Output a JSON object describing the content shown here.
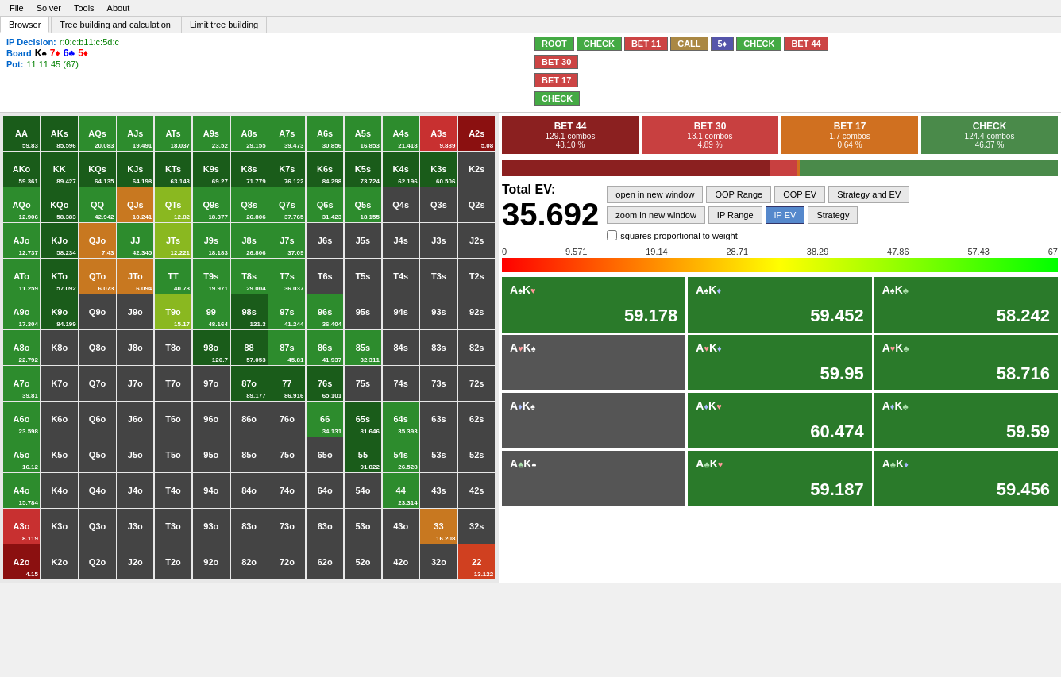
{
  "menubar": {
    "items": [
      "File",
      "Solver",
      "Tools",
      "About"
    ]
  },
  "tabs": {
    "items": [
      "Browser",
      "Tree building and calculation",
      "Limit tree building"
    ],
    "active": 0
  },
  "info": {
    "ip_decision_label": "IP Decision:",
    "ip_decision_value": "r:0:c:b11:c:5d:c",
    "board_label": "Board",
    "board_cards": [
      {
        "rank": "K",
        "suit": "♠",
        "color": "black"
      },
      {
        "rank": "7",
        "suit": "♦",
        "color": "red"
      },
      {
        "rank": "6",
        "suit": "♣",
        "color": "blue"
      },
      {
        "rank": "5",
        "suit": "♦",
        "color": "red"
      }
    ],
    "pot_label": "Pot:",
    "pot_value": "11 11 45 (67)"
  },
  "decision_path": [
    {
      "label": "ROOT",
      "class": "btn-root"
    },
    {
      "label": "CHECK",
      "class": "btn-check-g"
    },
    {
      "label": "BET 11",
      "class": "btn-bet11"
    },
    {
      "label": "CALL",
      "class": "btn-call"
    },
    {
      "label": "5♦",
      "class": "btn-5d"
    },
    {
      "label": "CHECK",
      "class": "btn-check-g2"
    },
    {
      "label": "BET 44",
      "class": "btn-bet44"
    },
    {
      "label": "BET 30",
      "class": "btn-bet30"
    },
    {
      "label": "BET 17",
      "class": "btn-bet17"
    },
    {
      "label": "CHECK",
      "class": "btn-check-g3"
    }
  ],
  "action_bars": [
    {
      "name": "BET 44",
      "combos": "129.1 combos",
      "pct": "48.10 %",
      "class": "ab-bet44"
    },
    {
      "name": "BET 30",
      "combos": "13.1 combos",
      "pct": "4.89 %",
      "class": "ab-bet30"
    },
    {
      "name": "BET 17",
      "combos": "1.7 combos",
      "pct": "0.64 %",
      "class": "ab-bet17"
    },
    {
      "name": "CHECK",
      "combos": "124.4 combos",
      "pct": "46.37 %",
      "class": "ab-check"
    }
  ],
  "freq_segments": [
    {
      "pct": 48.1,
      "color": "#8b2020"
    },
    {
      "pct": 4.89,
      "color": "#c84040"
    },
    {
      "pct": 0.64,
      "color": "#d07020"
    },
    {
      "pct": 46.37,
      "color": "#4a8a4a"
    }
  ],
  "total_ev": {
    "label": "Total EV:",
    "value": "35.692"
  },
  "ev_buttons": [
    {
      "label": "open in new window",
      "active": false
    },
    {
      "label": "OOP Range",
      "active": false
    },
    {
      "label": "OOP EV",
      "active": false
    },
    {
      "label": "Strategy and EV",
      "active": false
    },
    {
      "label": "zoom in new window",
      "active": false
    },
    {
      "label": "IP Range",
      "active": false
    },
    {
      "label": "IP EV",
      "active": true
    },
    {
      "label": "Strategy",
      "active": false
    }
  ],
  "checkbox_label": "squares proportional to weight",
  "scale_labels": [
    "0",
    "9.571",
    "19.14",
    "28.71",
    "38.29",
    "47.86",
    "57.43",
    "67"
  ],
  "hand_cards": [
    {
      "top": "A♠K♥",
      "ev": "59.178",
      "bg": "green",
      "suit_top": "spade-heart"
    },
    {
      "top": "A♠K♦",
      "ev": "59.452",
      "bg": "green",
      "suit_top": "spade-diamond"
    },
    {
      "top": "A♠K♣",
      "ev": "58.242",
      "bg": "green",
      "suit_top": "spade-club"
    },
    {
      "top": "A♥K♠",
      "ev": "",
      "bg": "gray",
      "suit_top": "heart-spade"
    },
    {
      "top": "A♥K♦",
      "ev": "59.95",
      "bg": "green",
      "suit_top": "heart-diamond"
    },
    {
      "top": "A♥K♣",
      "ev": "58.716",
      "bg": "green",
      "suit_top": "heart-club"
    },
    {
      "top": "A♦K♠",
      "ev": "",
      "bg": "gray",
      "suit_top": "diamond-spade"
    },
    {
      "top": "A♦K♥",
      "ev": "60.474",
      "bg": "green",
      "suit_top": "diamond-heart"
    },
    {
      "top": "A♦K♣",
      "ev": "59.59",
      "bg": "green",
      "suit_top": "diamond-club"
    },
    {
      "top": "A♣K♠",
      "ev": "",
      "bg": "gray",
      "suit_top": "club-spade"
    },
    {
      "top": "A♣K♥",
      "ev": "59.187",
      "bg": "green",
      "suit_top": "club-heart"
    },
    {
      "top": "A♣K♦",
      "ev": "59.456",
      "bg": "green",
      "suit_top": "club-diamond"
    }
  ],
  "grid_cells": [
    {
      "hand": "AA",
      "ev": "59.83",
      "color": "dark-green"
    },
    {
      "hand": "AKs",
      "ev": "85.596",
      "color": "dark-green"
    },
    {
      "hand": "AQs",
      "ev": "20.083",
      "color": "medium-green"
    },
    {
      "hand": "AJs",
      "ev": "19.491",
      "color": "medium-green"
    },
    {
      "hand": "ATs",
      "ev": "18.037",
      "color": "medium-green"
    },
    {
      "hand": "A9s",
      "ev": "23.52",
      "color": "medium-green"
    },
    {
      "hand": "A8s",
      "ev": "29.155",
      "color": "medium-green"
    },
    {
      "hand": "A7s",
      "ev": "39.473",
      "color": "medium-green"
    },
    {
      "hand": "A6s",
      "ev": "30.856",
      "color": "medium-green"
    },
    {
      "hand": "A5s",
      "ev": "16.853",
      "color": "medium-green"
    },
    {
      "hand": "A4s",
      "ev": "21.418",
      "color": "medium-green"
    },
    {
      "hand": "A3s",
      "ev": "9.889",
      "color": "red"
    },
    {
      "hand": "A2s",
      "ev": "5.08",
      "color": "dark-red"
    },
    {
      "hand": "AKo",
      "ev": "59.361",
      "color": "dark-green"
    },
    {
      "hand": "KK",
      "ev": "89.427",
      "color": "dark-green"
    },
    {
      "hand": "KQs",
      "ev": "64.135",
      "color": "dark-green"
    },
    {
      "hand": "KJs",
      "ev": "64.198",
      "color": "dark-green"
    },
    {
      "hand": "KTs",
      "ev": "63.143",
      "color": "dark-green"
    },
    {
      "hand": "K9s",
      "ev": "69.27",
      "color": "dark-green"
    },
    {
      "hand": "K8s",
      "ev": "71.779",
      "color": "dark-green"
    },
    {
      "hand": "K7s",
      "ev": "76.122",
      "color": "dark-green"
    },
    {
      "hand": "K6s",
      "ev": "84.298",
      "color": "dark-green"
    },
    {
      "hand": "K5s",
      "ev": "73.724",
      "color": "dark-green"
    },
    {
      "hand": "K4s",
      "ev": "62.196",
      "color": "dark-green"
    },
    {
      "hand": "K3s",
      "ev": "60.506",
      "color": "dark-green"
    },
    {
      "hand": "K2s",
      "ev": "",
      "color": "gray"
    },
    {
      "hand": "AQo",
      "ev": "12.906",
      "color": "medium-green"
    },
    {
      "hand": "KQo",
      "ev": "58.383",
      "color": "dark-green"
    },
    {
      "hand": "QQ",
      "ev": "42.942",
      "color": "medium-green"
    },
    {
      "hand": "QJs",
      "ev": "10.241",
      "color": "orange"
    },
    {
      "hand": "QTs",
      "ev": "12.82",
      "color": "yellow-green"
    },
    {
      "hand": "Q9s",
      "ev": "18.377",
      "color": "medium-green"
    },
    {
      "hand": "Q8s",
      "ev": "26.806",
      "color": "medium-green"
    },
    {
      "hand": "Q7s",
      "ev": "37.765",
      "color": "medium-green"
    },
    {
      "hand": "Q6s",
      "ev": "31.423",
      "color": "medium-green"
    },
    {
      "hand": "Q5s",
      "ev": "18.155",
      "color": "medium-green"
    },
    {
      "hand": "Q4s",
      "ev": "",
      "color": "gray"
    },
    {
      "hand": "Q3s",
      "ev": "",
      "color": "gray"
    },
    {
      "hand": "Q2s",
      "ev": "",
      "color": "gray"
    },
    {
      "hand": "AJo",
      "ev": "12.737",
      "color": "medium-green"
    },
    {
      "hand": "KJo",
      "ev": "58.234",
      "color": "dark-green"
    },
    {
      "hand": "QJo",
      "ev": "7.43",
      "color": "orange"
    },
    {
      "hand": "JJ",
      "ev": "42.345",
      "color": "medium-green"
    },
    {
      "hand": "JTs",
      "ev": "12.221",
      "color": "yellow-green"
    },
    {
      "hand": "J9s",
      "ev": "18.183",
      "color": "medium-green"
    },
    {
      "hand": "J8s",
      "ev": "26.806",
      "color": "medium-green"
    },
    {
      "hand": "J7s",
      "ev": "37.09",
      "color": "medium-green"
    },
    {
      "hand": "J6s",
      "ev": "",
      "color": "gray"
    },
    {
      "hand": "J5s",
      "ev": "",
      "color": "gray"
    },
    {
      "hand": "J4s",
      "ev": "",
      "color": "gray"
    },
    {
      "hand": "J3s",
      "ev": "",
      "color": "gray"
    },
    {
      "hand": "J2s",
      "ev": "",
      "color": "gray"
    },
    {
      "hand": "ATo",
      "ev": "11.259",
      "color": "medium-green"
    },
    {
      "hand": "KTo",
      "ev": "57.092",
      "color": "dark-green"
    },
    {
      "hand": "QTo",
      "ev": "6.073",
      "color": "orange"
    },
    {
      "hand": "JTo",
      "ev": "6.094",
      "color": "orange"
    },
    {
      "hand": "TT",
      "ev": "40.78",
      "color": "medium-green"
    },
    {
      "hand": "T9s",
      "ev": "19.971",
      "color": "medium-green"
    },
    {
      "hand": "T8s",
      "ev": "29.004",
      "color": "medium-green"
    },
    {
      "hand": "T7s",
      "ev": "36.037",
      "color": "medium-green"
    },
    {
      "hand": "T6s",
      "ev": "",
      "color": "gray"
    },
    {
      "hand": "T5s",
      "ev": "",
      "color": "gray"
    },
    {
      "hand": "T4s",
      "ev": "",
      "color": "gray"
    },
    {
      "hand": "T3s",
      "ev": "",
      "color": "gray"
    },
    {
      "hand": "T2s",
      "ev": "",
      "color": "gray"
    },
    {
      "hand": "A9o",
      "ev": "17.304",
      "color": "medium-green"
    },
    {
      "hand": "K9o",
      "ev": "84.199",
      "color": "dark-green"
    },
    {
      "hand": "Q9o",
      "ev": "",
      "color": "gray"
    },
    {
      "hand": "J9o",
      "ev": "",
      "color": "gray"
    },
    {
      "hand": "T9o",
      "ev": "15.17",
      "color": "yellow-green"
    },
    {
      "hand": "99",
      "ev": "48.164",
      "color": "medium-green"
    },
    {
      "hand": "98s",
      "ev": "121.3",
      "color": "dark-green"
    },
    {
      "hand": "97s",
      "ev": "41.244",
      "color": "medium-green"
    },
    {
      "hand": "96s",
      "ev": "36.404",
      "color": "medium-green"
    },
    {
      "hand": "95s",
      "ev": "",
      "color": "gray"
    },
    {
      "hand": "94s",
      "ev": "",
      "color": "gray"
    },
    {
      "hand": "93s",
      "ev": "",
      "color": "gray"
    },
    {
      "hand": "92s",
      "ev": "",
      "color": "gray"
    },
    {
      "hand": "A8o",
      "ev": "22.792",
      "color": "medium-green"
    },
    {
      "hand": "K8o",
      "ev": "",
      "color": "gray"
    },
    {
      "hand": "Q8o",
      "ev": "",
      "color": "gray"
    },
    {
      "hand": "J8o",
      "ev": "",
      "color": "gray"
    },
    {
      "hand": "T8o",
      "ev": "",
      "color": "gray"
    },
    {
      "hand": "98o",
      "ev": "120.7",
      "color": "dark-green"
    },
    {
      "hand": "88",
      "ev": "57.053",
      "color": "dark-green"
    },
    {
      "hand": "87s",
      "ev": "45.81",
      "color": "medium-green"
    },
    {
      "hand": "86s",
      "ev": "41.937",
      "color": "medium-green"
    },
    {
      "hand": "85s",
      "ev": "32.311",
      "color": "medium-green"
    },
    {
      "hand": "84s",
      "ev": "",
      "color": "gray"
    },
    {
      "hand": "83s",
      "ev": "",
      "color": "gray"
    },
    {
      "hand": "82s",
      "ev": "",
      "color": "gray"
    },
    {
      "hand": "A7o",
      "ev": "39.81",
      "color": "medium-green"
    },
    {
      "hand": "K7o",
      "ev": "",
      "color": "gray"
    },
    {
      "hand": "Q7o",
      "ev": "",
      "color": "gray"
    },
    {
      "hand": "J7o",
      "ev": "",
      "color": "gray"
    },
    {
      "hand": "T7o",
      "ev": "",
      "color": "gray"
    },
    {
      "hand": "97o",
      "ev": "",
      "color": "gray"
    },
    {
      "hand": "87o",
      "ev": "89.177",
      "color": "dark-green"
    },
    {
      "hand": "77",
      "ev": "86.916",
      "color": "dark-green"
    },
    {
      "hand": "76s",
      "ev": "65.101",
      "color": "dark-green"
    },
    {
      "hand": "75s",
      "ev": "",
      "color": "gray"
    },
    {
      "hand": "74s",
      "ev": "",
      "color": "gray"
    },
    {
      "hand": "73s",
      "ev": "",
      "color": "gray"
    },
    {
      "hand": "72s",
      "ev": "",
      "color": "gray"
    },
    {
      "hand": "A6o",
      "ev": "23.598",
      "color": "medium-green"
    },
    {
      "hand": "K6o",
      "ev": "",
      "color": "gray"
    },
    {
      "hand": "Q6o",
      "ev": "",
      "color": "gray"
    },
    {
      "hand": "J6o",
      "ev": "",
      "color": "gray"
    },
    {
      "hand": "T6o",
      "ev": "",
      "color": "gray"
    },
    {
      "hand": "96o",
      "ev": "",
      "color": "gray"
    },
    {
      "hand": "86o",
      "ev": "",
      "color": "gray"
    },
    {
      "hand": "76o",
      "ev": "",
      "color": "gray"
    },
    {
      "hand": "66",
      "ev": "34.131",
      "color": "medium-green"
    },
    {
      "hand": "65s",
      "ev": "81.646",
      "color": "dark-green"
    },
    {
      "hand": "64s",
      "ev": "35.393",
      "color": "medium-green"
    },
    {
      "hand": "63s",
      "ev": "",
      "color": "gray"
    },
    {
      "hand": "62s",
      "ev": "",
      "color": "gray"
    },
    {
      "hand": "A5o",
      "ev": "16.12",
      "color": "medium-green"
    },
    {
      "hand": "K5o",
      "ev": "",
      "color": "gray"
    },
    {
      "hand": "Q5o",
      "ev": "",
      "color": "gray"
    },
    {
      "hand": "J5o",
      "ev": "",
      "color": "gray"
    },
    {
      "hand": "T5o",
      "ev": "",
      "color": "gray"
    },
    {
      "hand": "95o",
      "ev": "",
      "color": "gray"
    },
    {
      "hand": "85o",
      "ev": "",
      "color": "gray"
    },
    {
      "hand": "75o",
      "ev": "",
      "color": "gray"
    },
    {
      "hand": "65o",
      "ev": "",
      "color": "gray"
    },
    {
      "hand": "55",
      "ev": "91.822",
      "color": "dark-green"
    },
    {
      "hand": "54s",
      "ev": "26.528",
      "color": "medium-green"
    },
    {
      "hand": "53s",
      "ev": "",
      "color": "gray"
    },
    {
      "hand": "52s",
      "ev": "",
      "color": "gray"
    },
    {
      "hand": "A4o",
      "ev": "15.784",
      "color": "medium-green"
    },
    {
      "hand": "K4o",
      "ev": "",
      "color": "gray"
    },
    {
      "hand": "Q4o",
      "ev": "",
      "color": "gray"
    },
    {
      "hand": "J4o",
      "ev": "",
      "color": "gray"
    },
    {
      "hand": "T4o",
      "ev": "",
      "color": "gray"
    },
    {
      "hand": "94o",
      "ev": "",
      "color": "gray"
    },
    {
      "hand": "84o",
      "ev": "",
      "color": "gray"
    },
    {
      "hand": "74o",
      "ev": "",
      "color": "gray"
    },
    {
      "hand": "64o",
      "ev": "",
      "color": "gray"
    },
    {
      "hand": "54o",
      "ev": "",
      "color": "gray"
    },
    {
      "hand": "44",
      "ev": "23.314",
      "color": "medium-green"
    },
    {
      "hand": "43s",
      "ev": "",
      "color": "gray"
    },
    {
      "hand": "42s",
      "ev": "",
      "color": "gray"
    },
    {
      "hand": "A3o",
      "ev": "8.119",
      "color": "red"
    },
    {
      "hand": "K3o",
      "ev": "",
      "color": "gray"
    },
    {
      "hand": "Q3o",
      "ev": "",
      "color": "gray"
    },
    {
      "hand": "J3o",
      "ev": "",
      "color": "gray"
    },
    {
      "hand": "T3o",
      "ev": "",
      "color": "gray"
    },
    {
      "hand": "93o",
      "ev": "",
      "color": "gray"
    },
    {
      "hand": "83o",
      "ev": "",
      "color": "gray"
    },
    {
      "hand": "73o",
      "ev": "",
      "color": "gray"
    },
    {
      "hand": "63o",
      "ev": "",
      "color": "gray"
    },
    {
      "hand": "53o",
      "ev": "",
      "color": "gray"
    },
    {
      "hand": "43o",
      "ev": "",
      "color": "gray"
    },
    {
      "hand": "33",
      "ev": "16.208",
      "color": "orange"
    },
    {
      "hand": "32s",
      "ev": "",
      "color": "gray"
    },
    {
      "hand": "A2o",
      "ev": "4.15",
      "color": "dark-red"
    },
    {
      "hand": "K2o",
      "ev": "",
      "color": "gray"
    },
    {
      "hand": "Q2o",
      "ev": "",
      "color": "gray"
    },
    {
      "hand": "J2o",
      "ev": "",
      "color": "gray"
    },
    {
      "hand": "T2o",
      "ev": "",
      "color": "gray"
    },
    {
      "hand": "92o",
      "ev": "",
      "color": "gray"
    },
    {
      "hand": "82o",
      "ev": "",
      "color": "gray"
    },
    {
      "hand": "72o",
      "ev": "",
      "color": "gray"
    },
    {
      "hand": "62o",
      "ev": "",
      "color": "gray"
    },
    {
      "hand": "52o",
      "ev": "",
      "color": "gray"
    },
    {
      "hand": "42o",
      "ev": "",
      "color": "gray"
    },
    {
      "hand": "32o",
      "ev": "",
      "color": "gray"
    },
    {
      "hand": "22",
      "ev": "13.122",
      "color": "orange-red"
    }
  ]
}
